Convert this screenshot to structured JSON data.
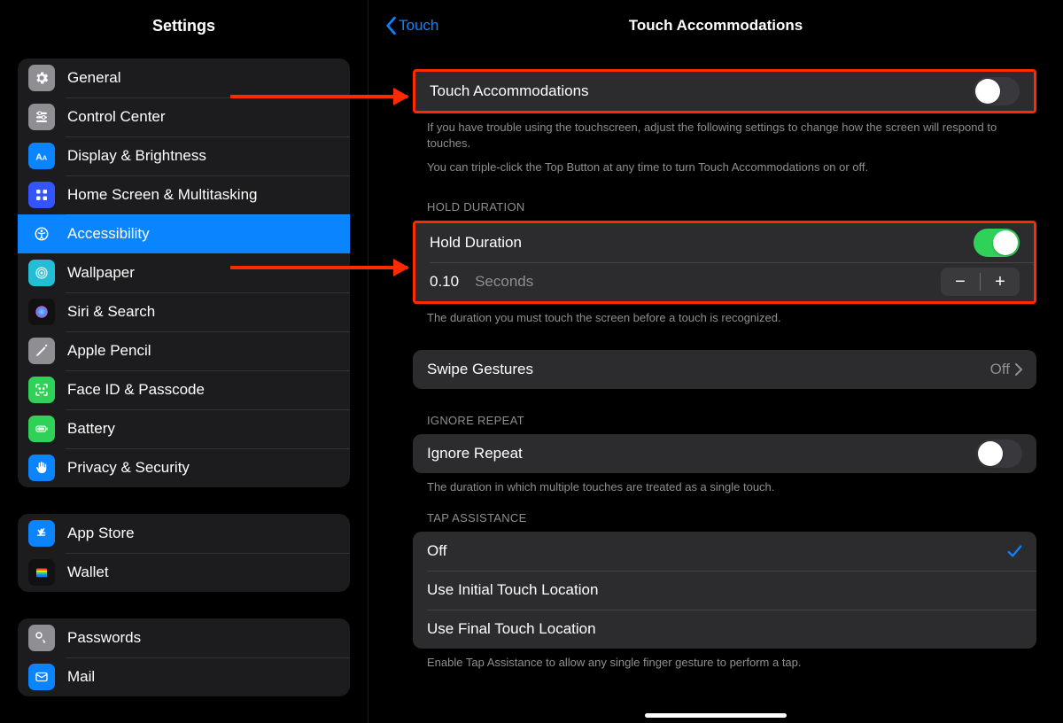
{
  "sidebar": {
    "title": "Settings",
    "groups": [
      {
        "items": [
          {
            "label": "General"
          },
          {
            "label": "Control Center"
          },
          {
            "label": "Display & Brightness"
          },
          {
            "label": "Home Screen & Multitasking"
          },
          {
            "label": "Accessibility",
            "selected": true
          },
          {
            "label": "Wallpaper"
          },
          {
            "label": "Siri & Search"
          },
          {
            "label": "Apple Pencil"
          },
          {
            "label": "Face ID & Passcode"
          },
          {
            "label": "Battery"
          },
          {
            "label": "Privacy & Security"
          }
        ]
      },
      {
        "items": [
          {
            "label": "App Store"
          },
          {
            "label": "Wallet"
          }
        ]
      },
      {
        "items": [
          {
            "label": "Passwords"
          },
          {
            "label": "Mail"
          }
        ]
      }
    ]
  },
  "detail": {
    "back_label": "Touch",
    "title": "Touch Accommodations",
    "touch_accommodations": {
      "label": "Touch Accommodations",
      "on": false,
      "footer1": "If you have trouble using the touchscreen, adjust the following settings to change how the screen will respond to touches.",
      "footer2": "You can triple-click the Top Button at any time to turn Touch Accommodations on or off."
    },
    "hold_duration": {
      "header": "HOLD DURATION",
      "label": "Hold Duration",
      "on": true,
      "value": "0.10",
      "unit": "Seconds",
      "footer": "The duration you must touch the screen before a touch is recognized."
    },
    "swipe_gestures": {
      "label": "Swipe Gestures",
      "value": "Off"
    },
    "ignore_repeat": {
      "header": "IGNORE REPEAT",
      "label": "Ignore Repeat",
      "on": false,
      "footer": "The duration in which multiple touches are treated as a single touch."
    },
    "tap_assistance": {
      "header": "TAP ASSISTANCE",
      "options": [
        {
          "label": "Off",
          "selected": true
        },
        {
          "label": "Use Initial Touch Location",
          "selected": false
        },
        {
          "label": "Use Final Touch Location",
          "selected": false
        }
      ],
      "footer": "Enable Tap Assistance to allow any single finger gesture to perform a tap."
    }
  }
}
